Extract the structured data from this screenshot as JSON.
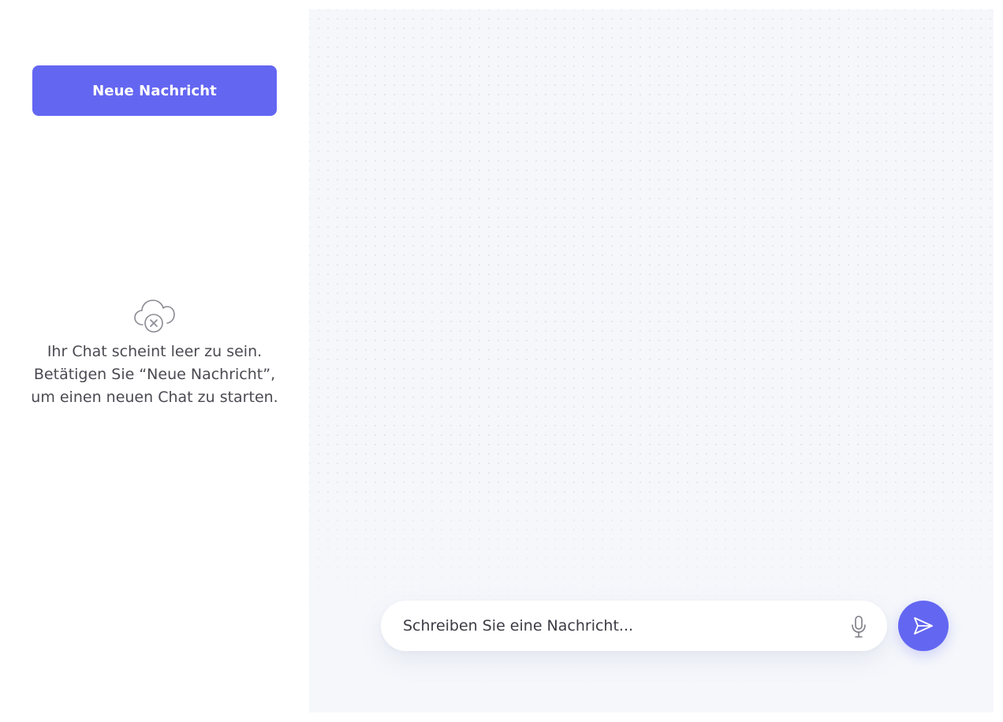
{
  "sidebar": {
    "new_message_label": "Neue Nachricht",
    "empty_state": {
      "icon": "cloud-off-icon",
      "lines": [
        "Ihr Chat scheint leer zu sein.",
        "Betätigen Sie “Neue Nachricht”,",
        "um einen neuen Chat zu starten."
      ]
    }
  },
  "chat": {
    "input": {
      "value": "",
      "placeholder": "Schreiben Sie eine Nachricht...",
      "mic_icon": "microphone-icon"
    },
    "send_icon": "send-icon"
  },
  "colors": {
    "accent": "#6366f1",
    "panel_background": "#f5f7fb",
    "text": "#4a4a52"
  }
}
